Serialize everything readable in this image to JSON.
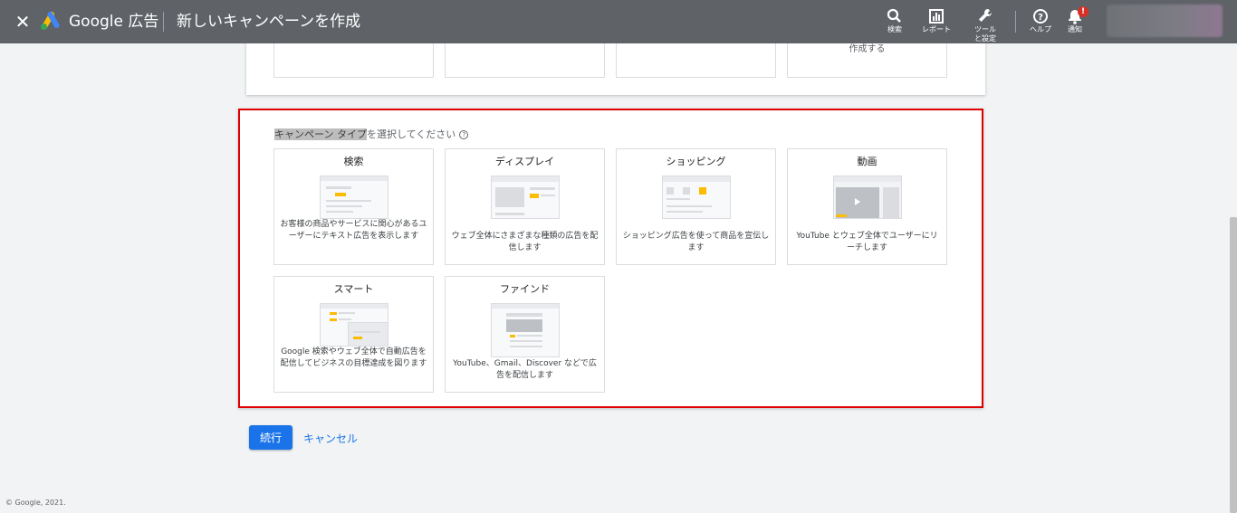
{
  "header": {
    "close_label": "✕",
    "brand": "Google 広告",
    "page_title": "新しいキャンペーンを作成",
    "tools": [
      {
        "name": "search",
        "icon": "search-icon",
        "label": "検索"
      },
      {
        "name": "report",
        "icon": "bar-chart-icon",
        "label": "レポート"
      },
      {
        "name": "tools",
        "icon": "wrench-icon",
        "label": "ツールと設定"
      },
      {
        "name": "help",
        "icon": "help-circle-icon",
        "label": "ヘルプ"
      },
      {
        "name": "notifications",
        "icon": "bell-icon",
        "label": "通知"
      }
    ],
    "notification_badge": "!"
  },
  "previous_section": {
    "partial_text": "作成する"
  },
  "campaign": {
    "heading_highlight": "キャンペーン タイプ",
    "heading_rest": "を選択してください",
    "help_mark": "?",
    "types": [
      {
        "title": "検索",
        "description": "お客様の商品やサービスに関心があるユーザーにテキスト広告を表示します"
      },
      {
        "title": "ディスプレイ",
        "description": "ウェブ全体にさまざまな種類の広告を配信します"
      },
      {
        "title": "ショッピング",
        "description": "ショッピング広告を使って商品を宣伝します"
      },
      {
        "title": "動画",
        "description": "YouTube とウェブ全体でユーザーにリーチします"
      },
      {
        "title": "スマート",
        "description": "Google 検索やウェブ全体で自動広告を配信してビジネスの目標達成を図ります"
      },
      {
        "title": "ファインド",
        "description": "YouTube、Gmail、Discover などで広告を配信します"
      }
    ]
  },
  "actions": {
    "continue_label": "続行",
    "cancel_label": "キャンセル"
  },
  "footer": {
    "copyright": "© Google, 2021."
  },
  "colors": {
    "topbar": "#5f6368",
    "primary": "#1a73e8",
    "highlight_border": "#e00000",
    "accent_yellow": "#fbbc04"
  }
}
